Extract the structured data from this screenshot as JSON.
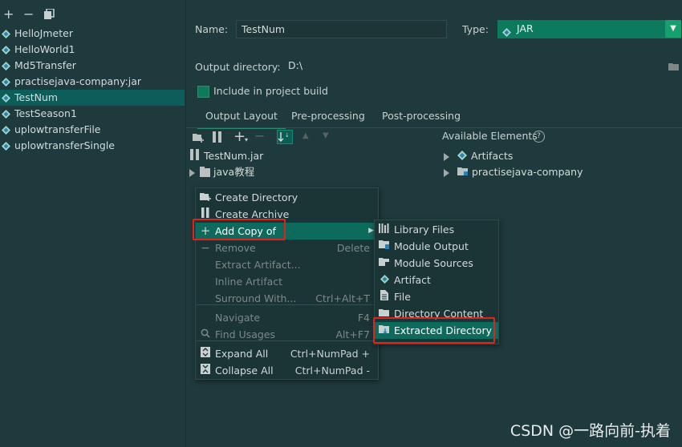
{
  "toolbar": {
    "icons": [
      "add-icon",
      "remove-icon",
      "copy-icon"
    ],
    "add": "+",
    "remove": "−"
  },
  "artifacts": [
    "HelloJmeter",
    "HelloWorld1",
    "Md5Transfer",
    "practisejava-company:jar",
    "TestNum",
    "TestSeason1",
    "uplowtransferFile",
    "uplowtransferSingle"
  ],
  "selected_artifact": "TestNum",
  "form": {
    "name_label": "Name:",
    "name_value": "TestNum",
    "type_label": "Type:",
    "type_value": "JAR",
    "output_dir_label": "Output directory:",
    "output_dir_value": "D:\\",
    "include_label": "Include in project build",
    "include_checked": true
  },
  "tabs": [
    "Output Layout",
    "Pre-processing",
    "Post-processing"
  ],
  "active_tab": "Output Layout",
  "layout_tree": {
    "root": "TestNum.jar",
    "child": "java教程"
  },
  "available": {
    "title": "Available Elements",
    "help": "?",
    "items": [
      "Artifacts",
      "practisejava-company"
    ]
  },
  "context_menu": {
    "items": [
      {
        "label": "Create Directory",
        "shortcut": "",
        "icon": "folder-plus-icon",
        "disabled": false
      },
      {
        "label": "Create Archive",
        "shortcut": "",
        "icon": "archive-icon",
        "disabled": false
      },
      {
        "label": "Add Copy of",
        "shortcut": "",
        "icon": "plus-icon",
        "disabled": false,
        "submenu": true,
        "highlighted": true
      },
      {
        "label": "Remove",
        "shortcut": "Delete",
        "icon": "minus-icon",
        "disabled": true
      },
      {
        "label": "Extract Artifact...",
        "shortcut": "",
        "icon": "",
        "disabled": true
      },
      {
        "label": "Inline Artifact",
        "shortcut": "",
        "icon": "",
        "disabled": true
      },
      {
        "label": "Surround With...",
        "shortcut": "Ctrl+Alt+T",
        "icon": "",
        "disabled": true
      },
      {
        "label": "Navigate",
        "shortcut": "F4",
        "icon": "",
        "disabled": true
      },
      {
        "label": "Find Usages",
        "shortcut": "Alt+F7",
        "icon": "search-icon",
        "disabled": true
      },
      {
        "label": "Expand All",
        "shortcut": "Ctrl+NumPad +",
        "icon": "expand-icon",
        "disabled": false
      },
      {
        "label": "Collapse All",
        "shortcut": "Ctrl+NumPad -",
        "icon": "collapse-icon",
        "disabled": false
      }
    ]
  },
  "submenu": {
    "items": [
      {
        "label": "Library Files",
        "icon": "library-icon"
      },
      {
        "label": "Module Output",
        "icon": "module-output-icon"
      },
      {
        "label": "Module Sources",
        "icon": "module-sources-icon"
      },
      {
        "label": "Artifact",
        "icon": "artifact-icon"
      },
      {
        "label": "File",
        "icon": "file-icon"
      },
      {
        "label": "Directory Content",
        "icon": "folder-icon"
      },
      {
        "label": "Extracted Directory",
        "icon": "extracted-directory-icon",
        "highlighted": true
      }
    ]
  },
  "watermark": "CSDN @一路向前-执着",
  "colors": {
    "background": "#1f3a3c",
    "selection": "#0d5d5a",
    "highlight": "#0c6b5d",
    "combo": "#0c7a5c",
    "annotation_red": "#e0231b"
  }
}
